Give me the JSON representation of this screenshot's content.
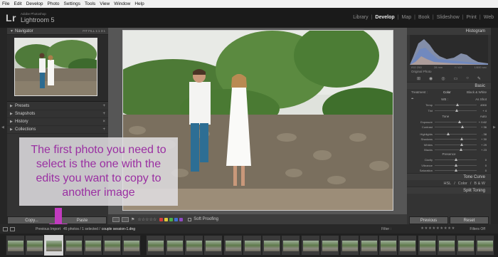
{
  "menubar": [
    "File",
    "Edit",
    "Develop",
    "Photo",
    "Settings",
    "Tools",
    "View",
    "Window",
    "Help"
  ],
  "app": {
    "logo": "Lr",
    "subtitle": "Adobe Photoshop",
    "title": "Lightroom 5"
  },
  "modules": [
    "Library",
    "Develop",
    "Map",
    "Book",
    "Slideshow",
    "Print",
    "Web"
  ],
  "active_module": "Develop",
  "left_panel": {
    "navigator": {
      "label": "Navigator",
      "options": "FIT   FILL   1:1   3:1"
    },
    "sections": [
      "Presets",
      "Snapshots",
      "History",
      "Collections"
    ]
  },
  "overlay_text": "The first photo you need to select is the one with the edits you want to copy to another image",
  "copy_label": "Copy...",
  "paste_label": "Paste",
  "toolbar": {
    "soft_proofing": "Soft Proofing",
    "colors": [
      "#d13b3b",
      "#e0c83a",
      "#4ab04a",
      "#3f6fd1",
      "#8f4ac2"
    ]
  },
  "right_panel": {
    "histogram_label": "Histogram",
    "histo_info": [
      "ISO 250",
      "28 mm",
      "f / 4.0",
      "1/500 sec"
    ],
    "original_photo": "Original Photo",
    "basic_label": "Basic",
    "treatment_label": "Treatment :",
    "treatment_color": "Color",
    "treatment_bw": "Black & White",
    "wb_label": "WB :",
    "wb_value": "As Shot",
    "tone_label": "Tone",
    "tone_auto": "Auto",
    "presence_label": "Presence",
    "sliders_wb": [
      {
        "label": "Temp",
        "value": "4900",
        "pos": 0.55
      },
      {
        "label": "Tint",
        "value": "+ 4",
        "pos": 0.52
      }
    ],
    "sliders_tone": [
      {
        "label": "Exposure",
        "value": "+ 0.62",
        "pos": 0.6
      },
      {
        "label": "Contrast",
        "value": "+ 36",
        "pos": 0.66
      }
    ],
    "sliders_tone2": [
      {
        "label": "Highlights",
        "value": "- 38",
        "pos": 0.32
      },
      {
        "label": "Shadows",
        "value": "+ 30",
        "pos": 0.65
      },
      {
        "label": "Whites",
        "value": "+ 29",
        "pos": 0.64
      },
      {
        "label": "Blacks",
        "value": "+ 23",
        "pos": 0.62
      }
    ],
    "sliders_presence": [
      {
        "label": "Clarity",
        "value": "0",
        "pos": 0.5
      },
      {
        "label": "Vibrance",
        "value": "0",
        "pos": 0.5
      },
      {
        "label": "Saturation",
        "value": "0",
        "pos": 0.5
      }
    ],
    "tone_curve_label": "Tone Curve",
    "hsl": [
      "HSL",
      "Color",
      "B & W"
    ],
    "split_toning_label": "Split Toning"
  },
  "previous_label": "Previous",
  "reset_label": "Reset",
  "filmstrip_bar": {
    "source": "Previous Import",
    "count": "45 photos / 1 selected /",
    "file": "couple session-1.dng",
    "filter_label": "Filter :",
    "stars": "★★★★★★★★★",
    "filters_off": "Filters Off"
  }
}
